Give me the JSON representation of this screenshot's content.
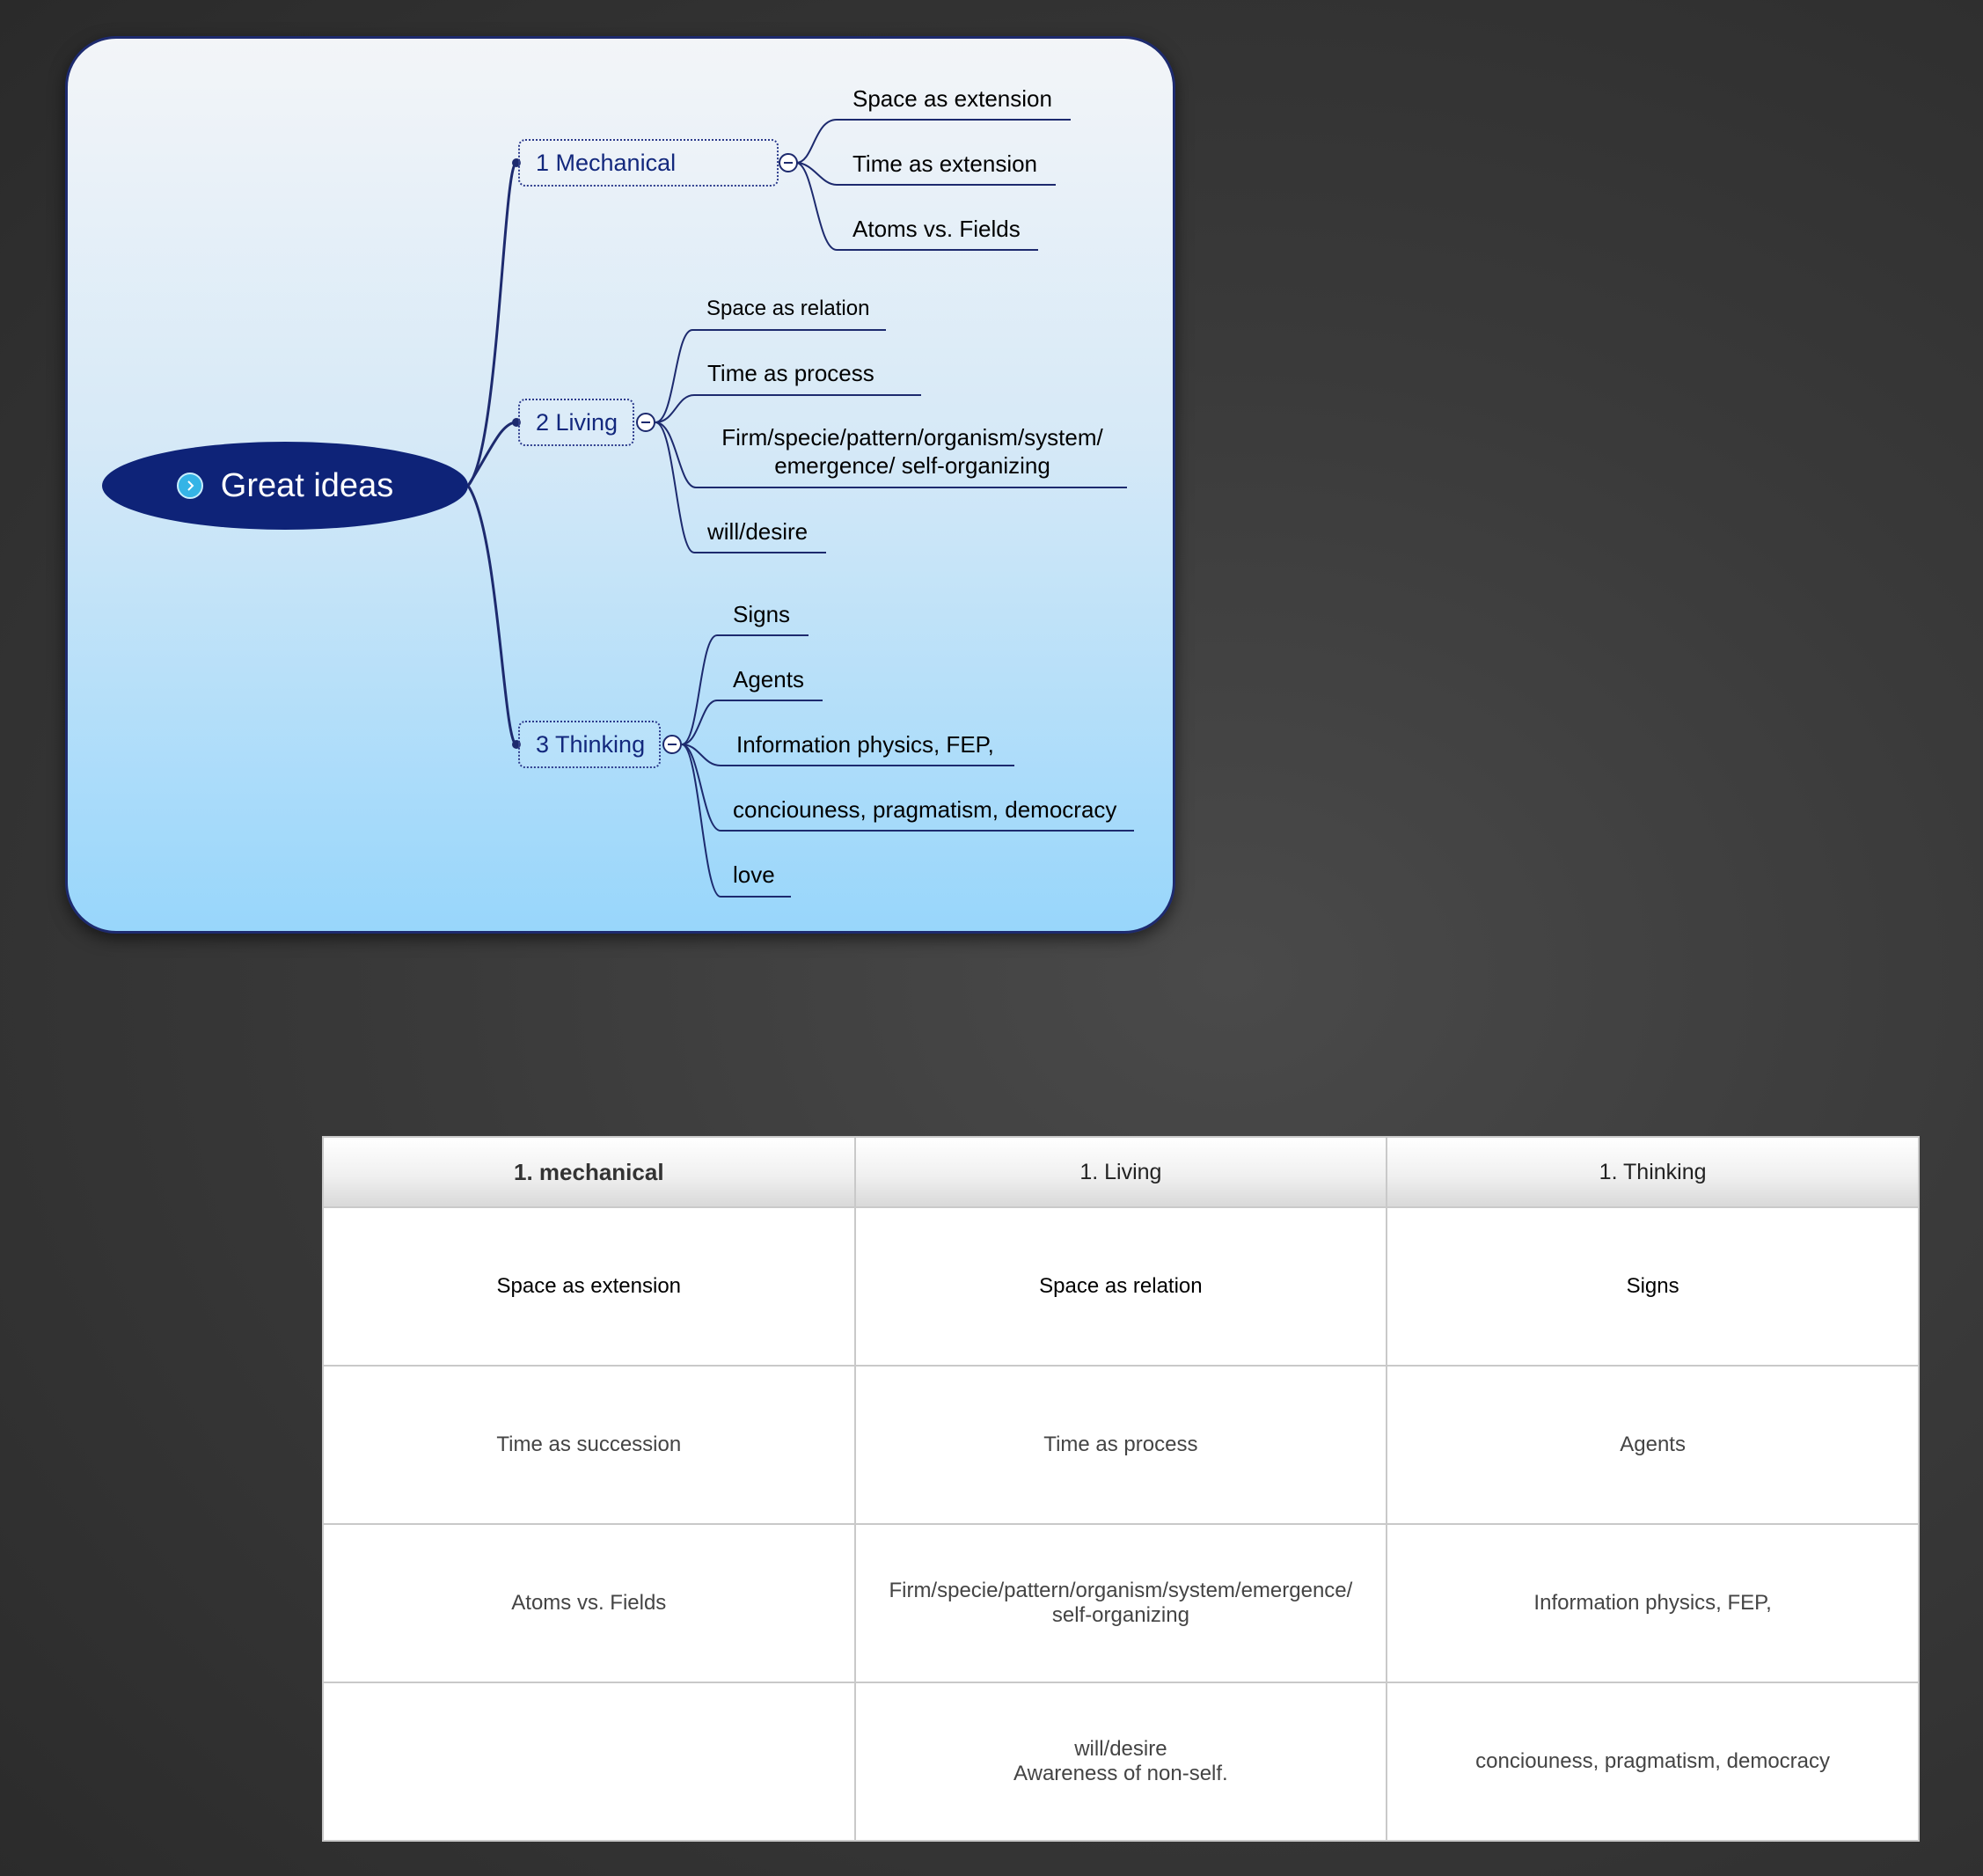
{
  "mindmap": {
    "root": "Great ideas",
    "branches": [
      {
        "label": "1 Mechanical",
        "children": [
          "Space as extension",
          "Time as extension",
          "Atoms vs. Fields"
        ]
      },
      {
        "label": "2 Living",
        "children": [
          "Space as relation",
          "Time as process",
          "Firm/specie/pattern/organism/system/ emergence/ self-organizing",
          "will/desire"
        ]
      },
      {
        "label": "3 Thinking",
        "children": [
          "Signs",
          "Agents",
          "Information physics, FEP,",
          "conciouness, pragmatism, democracy",
          "love"
        ]
      }
    ],
    "colors": {
      "root": "#0e2378",
      "connector": "#1d2a6e",
      "branch_text": "#13287d"
    }
  },
  "table": {
    "headers": [
      "1. mechanical",
      "1. Living",
      "1. Thinking"
    ],
    "rows": [
      [
        [
          "Space as extension"
        ],
        [
          "Space as relation"
        ],
        [
          "Signs"
        ]
      ],
      [
        [
          "Time as succession"
        ],
        [
          "Time as process"
        ],
        [
          "Agents"
        ]
      ],
      [
        [
          "Atoms vs. Fields"
        ],
        [
          "Firm/specie/pattern/organism/system/emergence/",
          "self-organizing"
        ],
        [
          "Information physics, FEP,"
        ]
      ],
      [
        [
          ""
        ],
        [
          "will/desire",
          "Awareness of non-self."
        ],
        [
          "conciouness, pragmatism, democracy"
        ]
      ]
    ]
  }
}
